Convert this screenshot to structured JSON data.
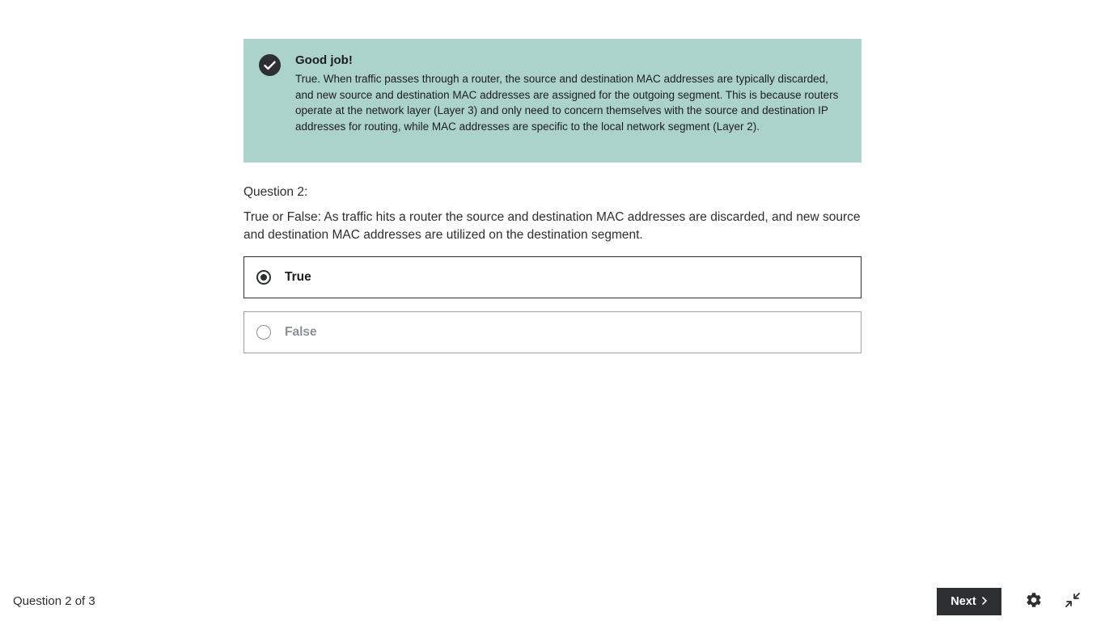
{
  "feedback": {
    "title": "Good job!",
    "text": "True. When traffic passes through a router, the source and destination MAC addresses are typically discarded, and new source and destination MAC addresses are assigned for the outgoing segment. This is because routers operate at the network layer (Layer 3) and only need to concern themselves with the source and destination IP addresses for routing, while MAC addresses are specific to the local network segment (Layer 2).",
    "icon": "check-circle-icon",
    "background_color": "#acd2cc"
  },
  "question": {
    "label": "Question 2:",
    "text": "True or False: As traffic hits a router the source and destination MAC addresses are discarded, and new source and destination MAC addresses are utilized on the destination segment."
  },
  "answers": [
    {
      "label": "True",
      "selected": true
    },
    {
      "label": "False",
      "selected": false
    }
  ],
  "footer": {
    "progress": "Question 2 of 3",
    "next_label": "Next",
    "next_icon": "chevron-right-icon",
    "settings_icon": "gear-icon",
    "exit_icon": "exit-fullscreen-icon"
  }
}
